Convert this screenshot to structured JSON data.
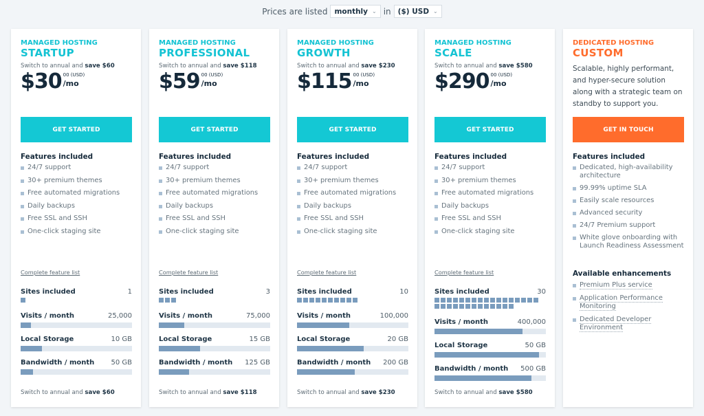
{
  "topbar": {
    "prefix": "Prices are listed",
    "billing_period": "monthly",
    "connector": "in",
    "currency": "($) USD"
  },
  "colors": {
    "accent": "#14c8d4",
    "accent_orange": "#ff6c2c",
    "bar_fill": "#7a9cbd",
    "bar_track": "#e2e9f0"
  },
  "labels": {
    "features_heading": "Features included",
    "complete_feature_list": "Complete feature list",
    "sites_label": "Sites included",
    "visits_label": "Visits / month",
    "storage_label": "Local Storage",
    "bandwidth_label": "Bandwidth / month",
    "save_prefix": "Switch to annual and",
    "cents": "00 (USD)",
    "per": "/mo"
  },
  "plans": [
    {
      "eyebrow": "MANAGED HOSTING",
      "name": "STARTUP",
      "save": "save $60",
      "price": "$30",
      "button": "GET STARTED",
      "features": [
        "24/7 support",
        "30+ premium themes",
        "Free automated migrations",
        "Daily backups",
        "Free SSL and SSH",
        "One-click staging site"
      ],
      "sites": 1,
      "sites_display": "1",
      "visits": "25,000",
      "visits_fill": 0.09,
      "storage": "10 GB",
      "storage_fill": 0.19,
      "bandwidth": "50 GB",
      "bandwidth_fill": 0.11
    },
    {
      "eyebrow": "MANAGED HOSTING",
      "name": "PROFESSIONAL",
      "save": "save $118",
      "price": "$59",
      "button": "GET STARTED",
      "features": [
        "24/7 support",
        "30+ premium themes",
        "Free automated migrations",
        "Daily backups",
        "Free SSL and SSH",
        "One-click staging site"
      ],
      "sites": 3,
      "sites_display": "3",
      "visits": "75,000",
      "visits_fill": 0.23,
      "storage": "15 GB",
      "storage_fill": 0.37,
      "bandwidth": "125 GB",
      "bandwidth_fill": 0.27
    },
    {
      "eyebrow": "MANAGED HOSTING",
      "name": "GROWTH",
      "save": "save $230",
      "price": "$115",
      "button": "GET STARTED",
      "features": [
        "24/7 support",
        "30+ premium themes",
        "Free automated migrations",
        "Daily backups",
        "Free SSL and SSH",
        "One-click staging site"
      ],
      "sites": 10,
      "sites_display": "10",
      "visits": "100,000",
      "visits_fill": 0.47,
      "storage": "20 GB",
      "storage_fill": 0.6,
      "bandwidth": "200 GB",
      "bandwidth_fill": 0.52
    },
    {
      "eyebrow": "MANAGED HOSTING",
      "name": "SCALE",
      "save": "save $580",
      "price": "$290",
      "button": "GET STARTED",
      "features": [
        "24/7 support",
        "30+ premium themes",
        "Free automated migrations",
        "Daily backups",
        "Free SSL and SSH",
        "One-click staging site"
      ],
      "sites": 30,
      "sites_display": "30",
      "visits": "400,000",
      "visits_fill": 0.79,
      "storage": "50 GB",
      "storage_fill": 0.94,
      "bandwidth": "500 GB",
      "bandwidth_fill": 0.87
    }
  ],
  "custom": {
    "eyebrow": "DEDICATED HOSTING",
    "name": "CUSTOM",
    "description": "Scalable, highly performant, and hyper-secure solution along with a strategic team on standby to support you.",
    "button": "GET IN TOUCH",
    "features_heading": "Features included",
    "features": [
      "Dedicated, high-availability architecture",
      "99.99% uptime SLA",
      "Easily scale resources",
      "Advanced security",
      "24/7 Premium support",
      "White glove onboarding with Launch Readiness Assessment"
    ],
    "enhancements_heading": "Available enhancements",
    "enhancements": [
      "Premium Plus service",
      "Application Performance Monitoring",
      "Dedicated Developer Environment"
    ]
  }
}
